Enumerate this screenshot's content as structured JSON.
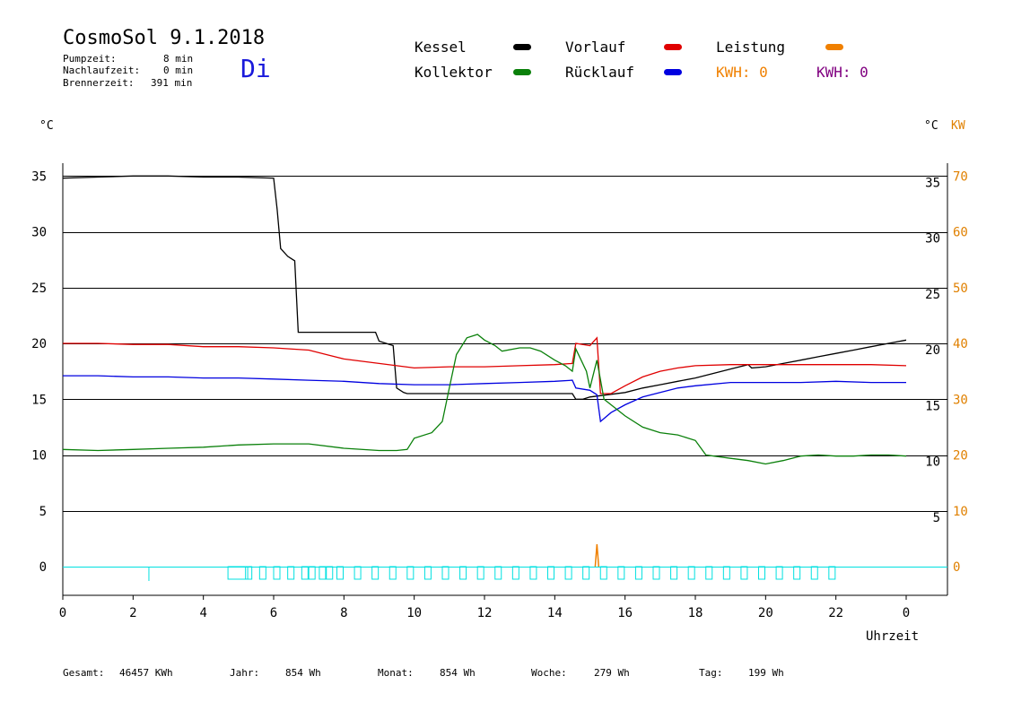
{
  "header": {
    "title": "CosmoSol 9.1.2018",
    "day": "Di",
    "pump_label": "Pumpzeit:",
    "pump_value": "8 min",
    "nach_label": "Nachlaufzeit:",
    "nach_value": "0 min",
    "brenner_label": "Brennerzeit:",
    "brenner_value": "391 min"
  },
  "legend": {
    "kessel": "Kessel",
    "kollektor": "Kollektor",
    "vorlauf": "Vorlauf",
    "ruecklauf": "Rücklauf",
    "leistung": "Leistung",
    "kwh1": "KWH: 0",
    "kwh2": "KWH: 0",
    "colors": {
      "kessel": "#000000",
      "kollektor": "#0a800a",
      "vorlauf": "#e00000",
      "ruecklauf": "#0000e0",
      "leistung": "#f08000",
      "kwh2": "#800080",
      "pump": "#00e0e0"
    }
  },
  "footer": {
    "gesamt_label": "Gesamt:",
    "gesamt_value": "46457 KWh",
    "jahr_label": "Jahr:",
    "jahr_value": "854 Wh",
    "monat_label": "Monat:",
    "monat_value": "854 Wh",
    "woche_label": "Woche:",
    "woche_value": "279 Wh",
    "tag_label": "Tag:",
    "tag_value": "199 Wh"
  },
  "chart_data": {
    "type": "line",
    "ylabel_left": "°C",
    "ylabel_right": "°C",
    "ylabel_right2": "KW",
    "xlabel": "Uhrzeit",
    "xlim": [
      0,
      24
    ],
    "ylim": [
      -2.5,
      36.5
    ],
    "x_ticks": [
      "0",
      "2",
      "4",
      "6",
      "8",
      "10",
      "12",
      "14",
      "16",
      "18",
      "20",
      "22",
      "0"
    ],
    "y_ticks_left": [
      "35",
      "30",
      "25",
      "20",
      "15",
      "10",
      "5",
      "0"
    ],
    "y_ticks_right": [
      "35",
      "30",
      "25",
      "20",
      "15",
      "10",
      "5"
    ],
    "y_ticks_kw": [
      "70",
      "60",
      "50",
      "40",
      "30",
      "20",
      "10",
      "0"
    ],
    "grid": true,
    "series": [
      {
        "name": "Kessel",
        "points": [
          [
            0,
            34.8
          ],
          [
            1,
            34.9
          ],
          [
            2,
            35.0
          ],
          [
            3,
            35.0
          ],
          [
            4,
            34.9
          ],
          [
            5,
            34.9
          ],
          [
            6,
            34.8
          ],
          [
            6.1,
            32
          ],
          [
            6.2,
            28.5
          ],
          [
            6.4,
            27.8
          ],
          [
            6.5,
            27.6
          ],
          [
            6.6,
            27.4
          ],
          [
            6.7,
            21
          ],
          [
            7,
            21
          ],
          [
            8,
            21
          ],
          [
            8.9,
            21
          ],
          [
            9.0,
            20.2
          ],
          [
            9.2,
            20.0
          ],
          [
            9.4,
            19.8
          ],
          [
            9.5,
            16
          ],
          [
            9.7,
            15.6
          ],
          [
            9.8,
            15.5
          ],
          [
            14.2,
            15.5
          ],
          [
            14.5,
            15.5
          ],
          [
            14.6,
            15.0
          ],
          [
            14.8,
            15.0
          ],
          [
            15.0,
            15.2
          ],
          [
            15.5,
            15.4
          ],
          [
            16,
            15.6
          ],
          [
            16.5,
            16.0
          ],
          [
            17,
            16.3
          ],
          [
            17.5,
            16.6
          ],
          [
            18,
            16.9
          ],
          [
            18.5,
            17.3
          ],
          [
            19,
            17.7
          ],
          [
            19.5,
            18.1
          ],
          [
            19.6,
            17.8
          ],
          [
            20,
            17.9
          ],
          [
            20.5,
            18.2
          ],
          [
            21,
            18.5
          ],
          [
            21.5,
            18.8
          ],
          [
            22,
            19.1
          ],
          [
            22.5,
            19.4
          ],
          [
            23,
            19.7
          ],
          [
            23.5,
            20.0
          ],
          [
            24,
            20.3
          ]
        ]
      },
      {
        "name": "Vorlauf",
        "points": [
          [
            0,
            20.0
          ],
          [
            1,
            20.0
          ],
          [
            2,
            19.9
          ],
          [
            3,
            19.9
          ],
          [
            4,
            19.7
          ],
          [
            5,
            19.7
          ],
          [
            6,
            19.6
          ],
          [
            7,
            19.4
          ],
          [
            7.5,
            19.0
          ],
          [
            8,
            18.6
          ],
          [
            9,
            18.2
          ],
          [
            10,
            17.8
          ],
          [
            11,
            17.9
          ],
          [
            12,
            17.9
          ],
          [
            13,
            18.0
          ],
          [
            14,
            18.1
          ],
          [
            14.5,
            18.2
          ],
          [
            14.6,
            20.0
          ],
          [
            15.0,
            19.8
          ],
          [
            15.2,
            20.5
          ],
          [
            15.3,
            15.5
          ],
          [
            15.6,
            15.5
          ],
          [
            16,
            16.2
          ],
          [
            16.5,
            17.0
          ],
          [
            17,
            17.5
          ],
          [
            17.5,
            17.8
          ],
          [
            18,
            18.0
          ],
          [
            19,
            18.1
          ],
          [
            20,
            18.1
          ],
          [
            21,
            18.1
          ],
          [
            22,
            18.1
          ],
          [
            23,
            18.1
          ],
          [
            24,
            18.0
          ]
        ]
      },
      {
        "name": "Rücklauf",
        "points": [
          [
            0,
            17.1
          ],
          [
            1,
            17.1
          ],
          [
            2,
            17.0
          ],
          [
            3,
            17.0
          ],
          [
            4,
            16.9
          ],
          [
            5,
            16.9
          ],
          [
            6,
            16.8
          ],
          [
            7,
            16.7
          ],
          [
            8,
            16.6
          ],
          [
            9,
            16.4
          ],
          [
            10,
            16.3
          ],
          [
            11,
            16.3
          ],
          [
            12,
            16.4
          ],
          [
            13,
            16.5
          ],
          [
            14,
            16.6
          ],
          [
            14.5,
            16.7
          ],
          [
            14.6,
            16.0
          ],
          [
            15.0,
            15.8
          ],
          [
            15.2,
            15.4
          ],
          [
            15.3,
            13.0
          ],
          [
            15.6,
            13.8
          ],
          [
            16,
            14.5
          ],
          [
            16.5,
            15.2
          ],
          [
            17,
            15.6
          ],
          [
            17.5,
            16.0
          ],
          [
            18,
            16.2
          ],
          [
            19,
            16.5
          ],
          [
            20,
            16.5
          ],
          [
            21,
            16.5
          ],
          [
            22,
            16.6
          ],
          [
            23,
            16.5
          ],
          [
            24,
            16.5
          ]
        ]
      },
      {
        "name": "Kollektor",
        "points": [
          [
            0,
            10.5
          ],
          [
            1,
            10.4
          ],
          [
            2,
            10.5
          ],
          [
            3,
            10.6
          ],
          [
            4,
            10.7
          ],
          [
            5,
            10.9
          ],
          [
            6,
            11.0
          ],
          [
            7,
            11.0
          ],
          [
            8,
            10.6
          ],
          [
            9,
            10.4
          ],
          [
            9.5,
            10.4
          ],
          [
            9.8,
            10.5
          ],
          [
            10,
            11.5
          ],
          [
            10.5,
            12.0
          ],
          [
            10.8,
            13.0
          ],
          [
            11,
            16.0
          ],
          [
            11.2,
            19.0
          ],
          [
            11.5,
            20.5
          ],
          [
            11.8,
            20.8
          ],
          [
            12,
            20.3
          ],
          [
            12.3,
            19.8
          ],
          [
            12.5,
            19.3
          ],
          [
            13,
            19.6
          ],
          [
            13.3,
            19.6
          ],
          [
            13.6,
            19.3
          ],
          [
            14,
            18.5
          ],
          [
            14.3,
            18.0
          ],
          [
            14.5,
            17.5
          ],
          [
            14.6,
            19.5
          ],
          [
            14.9,
            17.5
          ],
          [
            15.0,
            16.0
          ],
          [
            15.2,
            18.5
          ],
          [
            15.4,
            15.0
          ],
          [
            16,
            13.5
          ],
          [
            16.5,
            12.5
          ],
          [
            17,
            12.0
          ],
          [
            17.5,
            11.8
          ],
          [
            18,
            11.3
          ],
          [
            18.3,
            10.0
          ],
          [
            19,
            9.7
          ],
          [
            19.5,
            9.5
          ],
          [
            20,
            9.2
          ],
          [
            20.5,
            9.5
          ],
          [
            21,
            9.9
          ],
          [
            21.5,
            10.0
          ],
          [
            22,
            9.9
          ],
          [
            22.5,
            9.9
          ],
          [
            23,
            10.0
          ],
          [
            23.5,
            10.0
          ],
          [
            24,
            9.9
          ]
        ]
      }
    ],
    "pump_activity_hours": [
      4.7,
      5.2,
      5.6,
      6.0,
      6.4,
      6.8,
      7.0,
      7.3,
      7.5,
      7.8,
      8.3,
      8.8,
      9.3,
      9.8,
      10.3,
      10.8,
      11.3,
      11.8,
      12.3,
      12.8,
      13.3,
      13.8,
      14.3,
      14.8,
      15.3,
      15.8,
      16.3,
      16.8,
      17.3,
      17.8,
      18.3,
      18.8,
      19.3,
      19.8,
      20.3,
      20.8,
      21.3,
      21.8
    ],
    "leistung_peak": {
      "x": 15.2,
      "y": 4
    }
  }
}
